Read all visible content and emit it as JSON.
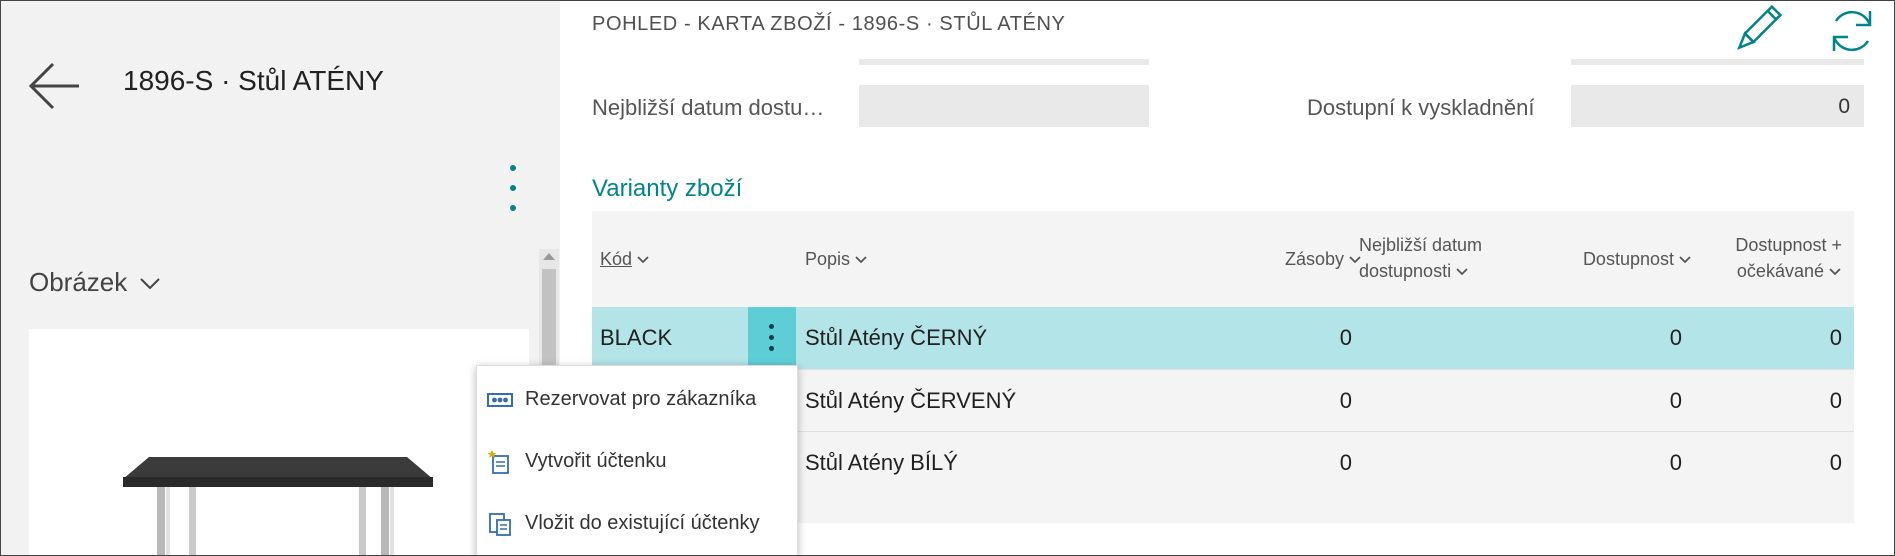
{
  "header": {
    "page_heading": "1896-S · Stůl ATÉNY",
    "view_title": "POHLED - KARTA ZBOŽÍ - 1896-S · STŮL ATÉNY"
  },
  "left": {
    "picture_section": "Obrázek"
  },
  "fields": {
    "next_availability_label": "Nejbližší datum dostu…",
    "next_availability_value": "",
    "available_to_pick_label": "Dostupní k vyskladnění",
    "available_to_pick_value": "0"
  },
  "variants": {
    "title": "Varianty zboží",
    "columns": {
      "code": "Kód",
      "description": "Popis",
      "inventory": "Zásoby",
      "next_date_line1": "Nejbližší datum",
      "next_date_line2": "dostupnosti",
      "availability": "Dostupnost",
      "avail_expected_line1": "Dostupnost +",
      "avail_expected_line2": "očekávané"
    },
    "rows": [
      {
        "code": "BLACK",
        "description": "Stůl Atény ČERNÝ",
        "inventory": "0",
        "next_date": "",
        "availability": "0",
        "avail_expected": "0"
      },
      {
        "code": "",
        "description": "Stůl Atény ČERVENÝ",
        "inventory": "0",
        "next_date": "",
        "availability": "0",
        "avail_expected": "0"
      },
      {
        "code": "",
        "description": "Stůl Atény BÍLÝ",
        "inventory": "0",
        "next_date": "",
        "availability": "0",
        "avail_expected": "0"
      }
    ]
  },
  "context_menu": {
    "items": [
      {
        "label": "Rezervovat pro zákazníka",
        "icon": "reserve-icon"
      },
      {
        "label": "Vytvořit účtenku",
        "icon": "new-receipt-icon"
      },
      {
        "label": "Vložit do existující účtenky",
        "icon": "insert-receipt-icon"
      }
    ]
  },
  "colors": {
    "accent": "#00848b",
    "selected_row": "#b2e4e8",
    "row_menu_button": "#5fcdd6"
  }
}
